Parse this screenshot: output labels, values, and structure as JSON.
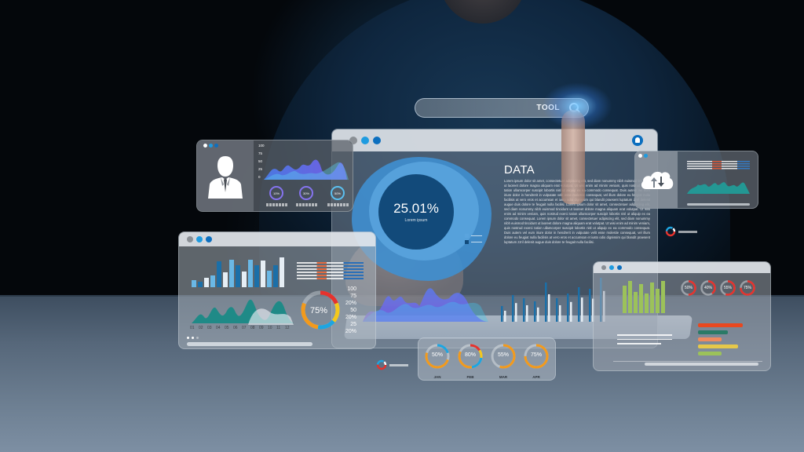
{
  "scene": {
    "description": "Person in dark sweater touching holographic business analytics dashboards above a keyboard",
    "colors": {
      "accent_blue": "#1e9be0",
      "dark_blue": "#0c6fbf",
      "teal": "#1f8a87",
      "orange": "#f29a1c",
      "red": "#e5322d",
      "yellow": "#f4c81a",
      "violet": "#7a6cf0"
    }
  },
  "search": {
    "value": "TOOL",
    "icon": "search-icon"
  },
  "main_window": {
    "icon": "user-lock-icon",
    "donut": {
      "value": "25.01%",
      "label": "Lorem ipsum"
    },
    "title": "DATA",
    "body": "Lorem ipsum dolor sit amet, consectetuer adipiscing elit, sed diam nonummy nibh euismod tincidunt ut laoreet dolore magna aliquam erat volutpat. Ut wisi enim ad minim veniam, quis nostrud exerci tation ullamcorper suscipit lobortis nisl ut aliquip ex ea commodo consequat. Duis autem vel eum iriure dolor in hendrerit in vulputate velit esse molestie consequat, vel illum dolore eu feugiat nulla facilisis at vero eros et accumsan et iusto odio dignissim qui blandit praesent luptatum zzril delenit augue duis dolore te feugait nulla facilisi. Lorem ipsum dolor sit amet, consectetuer adipiscing elit, sed diam nonummy nibh euismod tincidunt ut laoreet dolore magna aliquam erat volutpat. Ut wisi enim ad minim veniam, quis nostrud exerci tation ullamcorper suscipit lobortis nisl ut aliquip ex ea commodo consequat. Lorem ipsum dolor sit amet, consectetuer adipiscing elit, sed diam nonummy nibh euismod tincidunt ut laoreet dolore magna aliquam erat volutpat. Ut wisi enim ad minim veniam, quis nostrud exerci tation ullamcorper suscipit lobortis nisl ut aliquip ex ea commodo consequat. Duis autem vel eum iriure dolor in hendrerit in vulputate velit esse molestie consequat, vel illum dolore eu feugiat nulla facilisis at vero eros et accumsan et iusto odio dignissim qui blandit praesent luptatum zzril delenit augue duis dolore te feugait nulla facilisi."
  },
  "profile_panel": {
    "icon": "person-icon",
    "y_ticks": [
      "100",
      "75",
      "50",
      "25",
      "0"
    ],
    "rings": [
      "10%",
      "30%",
      "50%"
    ]
  },
  "analytics_panel": {
    "bar_values": [
      22,
      18,
      30,
      38,
      82,
      48,
      88,
      70,
      50,
      88,
      70,
      85,
      52,
      70,
      95
    ],
    "x_labels": [
      "01",
      "02",
      "03",
      "04",
      "05",
      "06",
      "07",
      "08",
      "09",
      "10",
      "11",
      "12"
    ],
    "donut_value": "75%",
    "side_labels": [
      "100",
      "75",
      "20%",
      "50",
      "20%",
      "25",
      "20%"
    ]
  },
  "right_panel": {
    "rings": [
      {
        "value": "50%",
        "fraction": 0.5
      },
      {
        "value": "40%",
        "fraction": 0.4
      },
      {
        "value": "55%",
        "fraction": 0.55
      },
      {
        "value": "75%",
        "fraction": 0.75
      }
    ],
    "hbars": [
      {
        "color": "#e8481f",
        "fraction": 1.0
      },
      {
        "color": "#2a7a66",
        "fraction": 0.66
      },
      {
        "color": "#ee8a5e",
        "fraction": 0.52
      },
      {
        "color": "#e6c84a",
        "fraction": 0.9
      },
      {
        "color": "#9cc25a",
        "fraction": 0.52
      }
    ]
  },
  "monthly_panel": {
    "months": [
      {
        "label": "JAN",
        "value": "50%",
        "fraction": 0.5
      },
      {
        "label": "FEB",
        "value": "80%",
        "fraction": 0.8
      },
      {
        "label": "MAR",
        "value": "55%",
        "fraction": 0.55
      },
      {
        "label": "APR",
        "value": "75%",
        "fraction": 0.75
      }
    ]
  },
  "cloud_panel": {
    "icon": "cloud-sync-icon"
  }
}
